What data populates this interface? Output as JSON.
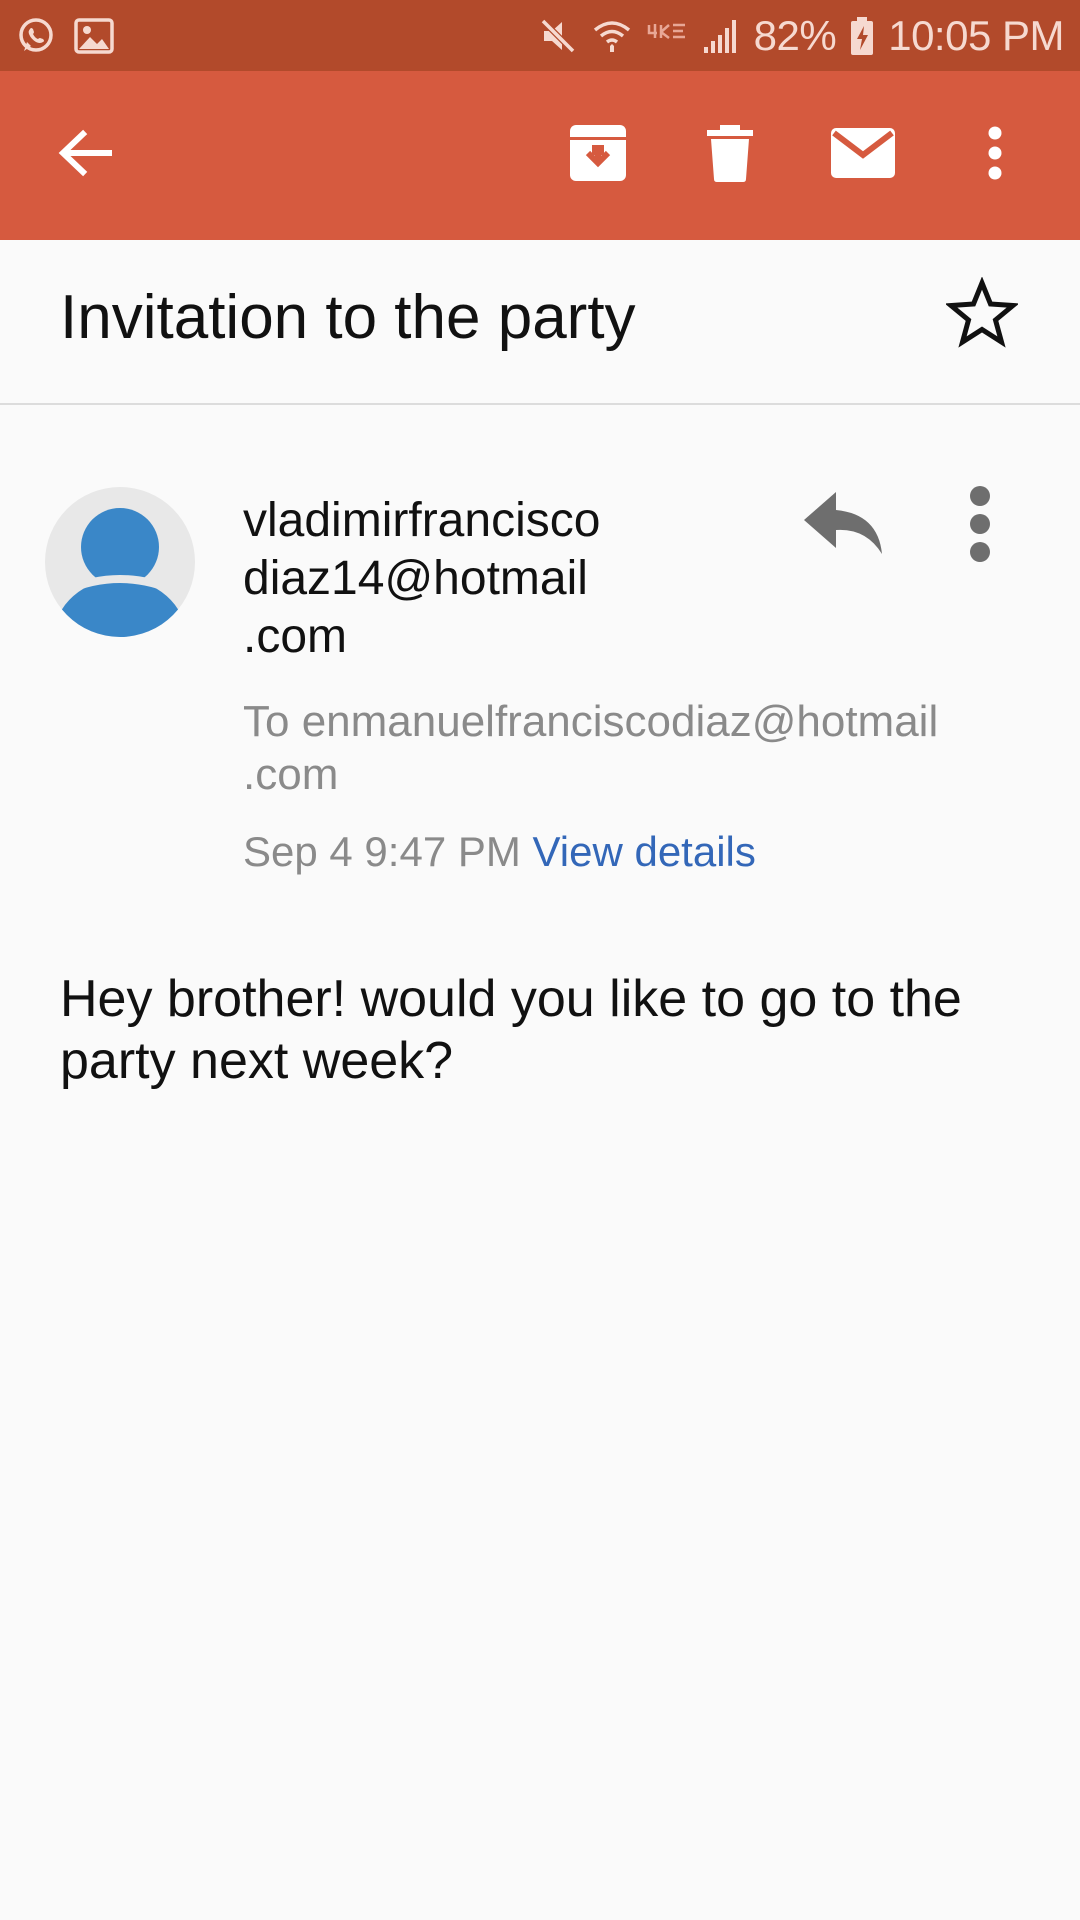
{
  "status_bar": {
    "battery": "82%",
    "time": "10:05 PM",
    "left_icons": [
      "whatsapp-icon",
      "image-icon"
    ],
    "right_icons": [
      "mute-icon",
      "wifi-icon",
      "network-type-icon",
      "signal-icon",
      "battery-charging-icon"
    ]
  },
  "toolbar": {
    "icons": [
      "back-arrow-icon",
      "archive-icon",
      "delete-icon",
      "mail-icon",
      "more-vert-icon"
    ],
    "background": "#d65a3f",
    "status_background": "#b24a2b"
  },
  "email": {
    "subject": "Invitation to the party",
    "sender": "vladimirfrancisco\ndiaz14@hotmail\n.com",
    "recipient": "To enmanuelfranciscodiaz@hotmail\n.com",
    "date": "Sep 4 9:47 PM",
    "view_details": "View details",
    "body": "Hey brother! would you like to go to the party next week?"
  },
  "colors": {
    "link": "#3367b8",
    "avatar": "#3a87c8"
  }
}
